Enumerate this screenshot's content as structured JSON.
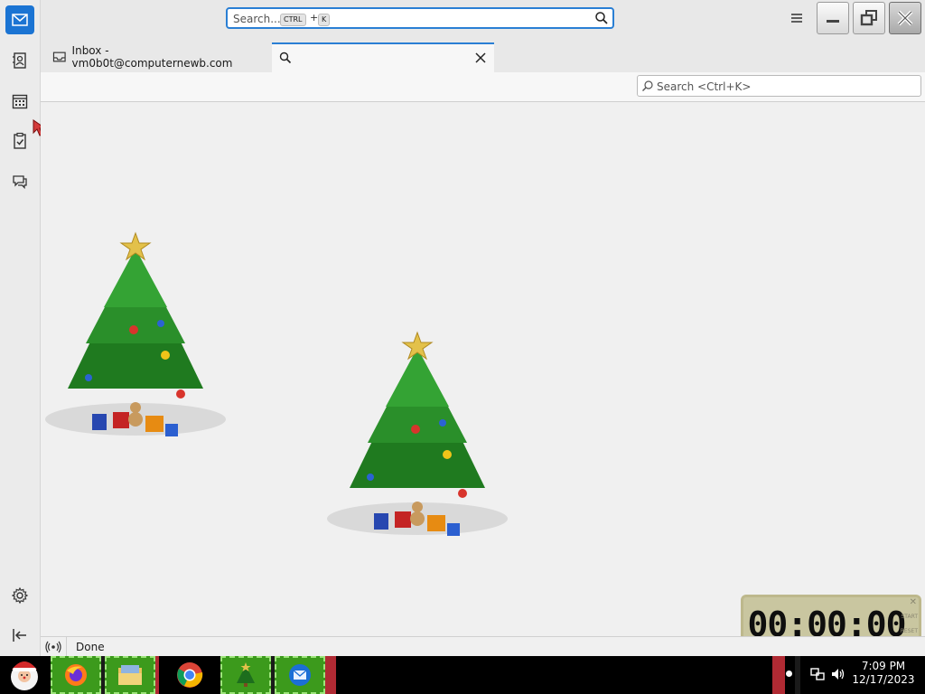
{
  "titlebar": {
    "search_placeholder": "Search...",
    "kbd_ctrl": "CTRL",
    "kbd_plus": "+",
    "kbd_k": "K"
  },
  "tabs": [
    {
      "label": "Inbox - vm0b0t@computernewb.com"
    },
    {
      "label": ""
    }
  ],
  "quick_filter": {
    "placeholder": "Search <Ctrl+K>"
  },
  "status": {
    "text": "Done"
  },
  "timer": {
    "digits": "00:00:00",
    "start_label": "START",
    "reset_label": "RESET"
  },
  "tray": {
    "time": "7:09 PM",
    "date": "12/17/2023"
  },
  "icons": {
    "spaces": [
      "mail-icon",
      "address-book-icon",
      "calendar-icon",
      "tasks-icon",
      "chat-icon",
      "settings-icon",
      "collapse-icon"
    ],
    "taskbar": [
      "santa-start-icon",
      "firefox-icon",
      "file-explorer-icon",
      "chrome-icon",
      "christmas-tree-app-icon",
      "thunderbird-icon"
    ]
  },
  "colors": {
    "accent": "#2a7fd4",
    "taskbar_button": "#3c9a1c",
    "taskbar_separator": "#b02a33",
    "mail_space": "#1b74d3"
  }
}
